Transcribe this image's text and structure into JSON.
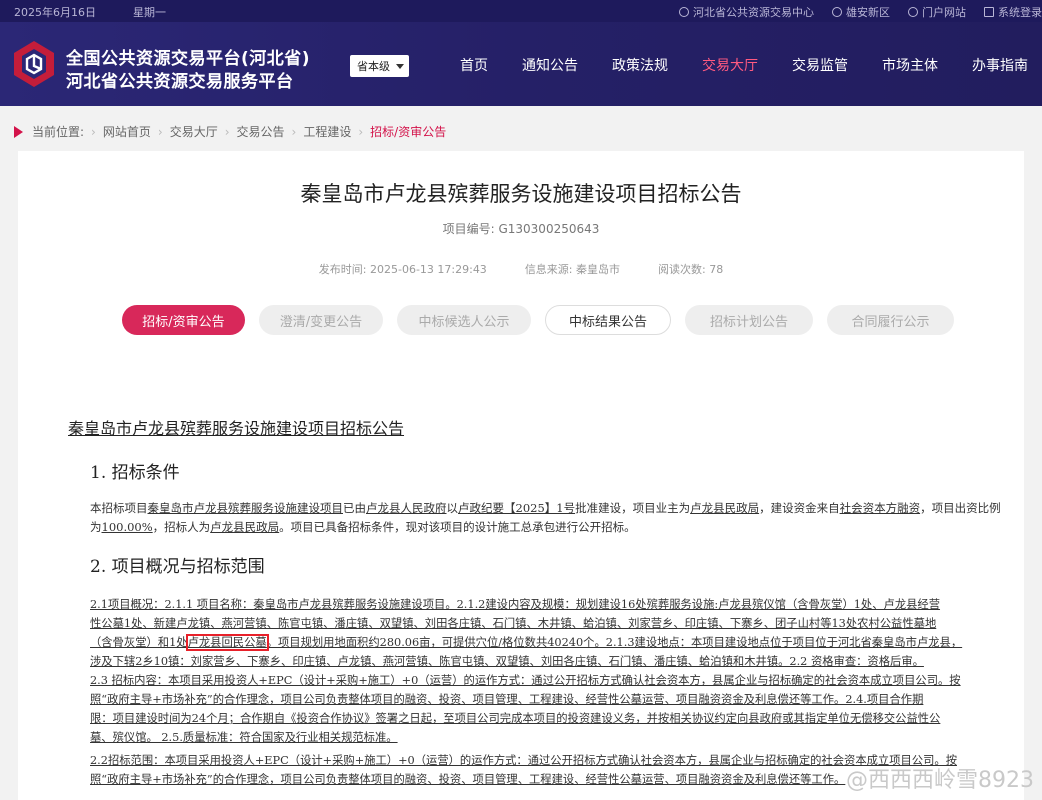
{
  "topbar": {
    "date": "2025年6月16日",
    "weekday": "星期一",
    "links": [
      {
        "label": "河北省公共资源交易中心",
        "icon": "globe-icon"
      },
      {
        "label": "雄安新区",
        "icon": "location-icon"
      },
      {
        "label": "门户网站",
        "icon": "globe-icon"
      },
      {
        "label": "系统登录",
        "icon": "login-icon"
      }
    ]
  },
  "header": {
    "brand_line1": "全国公共资源交易平台(河北省)",
    "brand_line2": "河北省公共资源交易服务平台",
    "level_select": "省本级",
    "nav": [
      "首页",
      "通知公告",
      "政策法规",
      "交易大厅",
      "交易监管",
      "市场主体",
      "办事指南"
    ],
    "active_nav": "交易大厅",
    "accent": "#ff5a80",
    "bg": "#2b2776"
  },
  "breadcrumb": {
    "label": "当前位置:",
    "items": [
      "网站首页",
      "交易大厅",
      "交易公告",
      "工程建设"
    ],
    "current": "招标/资审公告"
  },
  "article": {
    "title": "秦皇岛市卢龙县殡葬服务设施建设项目招标公告",
    "project_no": "项目编号:  G130300250643",
    "publish_time": "发布时间:  2025-06-13 17:29:43",
    "source": "信息来源:     秦皇岛市",
    "views": "阅读次数:     78",
    "tabs": [
      {
        "label": "招标/资审公告",
        "state": "active"
      },
      {
        "label": "澄清/变更公告",
        "state": "disabled"
      },
      {
        "label": "中标候选人公示",
        "state": "disabled"
      },
      {
        "label": "中标结果公告",
        "state": "enabled"
      },
      {
        "label": "招标计划公告",
        "state": "disabled"
      },
      {
        "label": "合同履行公示",
        "state": "disabled"
      }
    ]
  },
  "document": {
    "title": "秦皇岛市卢龙县殡葬服务设施建设项目招标公告",
    "section1_heading": "1.  招标条件",
    "section1_text": {
      "a": "本招标项目",
      "b": "秦皇岛市卢龙县殡葬服务设施建设项目",
      "c": "已由",
      "d": "卢龙县人民政府",
      "e": "以",
      "f": "卢政纪要【2025】1号",
      "g": "批准建设，项目业主为",
      "h": "卢龙县民政局",
      "i": "，建设资金来自",
      "j": "社会资本方融资",
      "k": "，项目出资比例为",
      "l": "100.00%",
      "m": "，招标人为",
      "n": "卢龙县民政局",
      "o": "。项目已具备招标条件，现对该项目的设计施工总承包进行公开招标。"
    },
    "section2_heading": "2.  项目概况与招标范围",
    "section2_lines": [
      "2.1项目概况：2.1.1 项目名称：秦皇岛市卢龙县殡葬服务设施建设项目。2.1.2建设内容及规模：规划建设16处殡葬服务设施:卢龙县殡仪馆（含骨灰堂）1处、卢龙县经营",
      "性公墓1处、新建卢龙镇、燕河营镇、陈官屯镇、潘庄镇、双望镇、刘田各庄镇、石门镇、木井镇、蛤泊镇、刘家营乡、印庄镇、下寨乡、团子山村等13处农村公益性墓地",
      "涉及下辖2乡10镇：刘家营乡、下寨乡、印庄镇、卢龙镇、燕河营镇、陈官屯镇、双望镇、刘田各庄镇、石门镇、潘庄镇、蛤泊镇和木井镇。2.2 资格审查：资格后审。",
      "2.3 招标内容：本项目采用投资人+EPC（设计+采购+施工）+0（运营）的运作方式：通过公开招标方式确认社会资本方，县属企业与招标确定的社会资本成立项目公司。按",
      "照“政府主导+市场补充”的合作理念，项目公司负责整体项目的融资、投资、项目管理、工程建设、经营性公墓运营、项目融资资金及利息偿还等工作。2.4.项目合作期",
      "限：项目建设时间为24个月；合作期自《投资合作协议》签署之日起，至项目公司完成本项目的投资建设义务，并按相关协议约定向县政府或其指定单位无偿移交公益性公",
      "墓、殡仪馆。 2.5.质量标准：符合国家及行业相关规范标准。",
      "2.2招标范围：本项目采用投资人+EPC（设计+采购+施工）+0（运营）的运作方式：通过公开招标方式确认社会资本方，县属企业与招标确定的社会资本成立项目公司。按",
      "照“政府主导+市场补充”的合作理念，项目公司负责整体项目的融资、投资、项目管理、工程建设、经营性公墓运营、项目融资资金及利息偿还等工作。"
    ],
    "line3_parts": {
      "a": "（含骨灰堂）和1处",
      "b": "卢龙县回民公墓",
      "c": "。项目规划用地面积约280.06亩，可提供穴位/格位数共40240个。2.1.3建设地点：本项目建设地点位于项目位于河北省秦皇岛市卢龙县，"
    }
  },
  "watermark": "@西西西岭雪8923"
}
